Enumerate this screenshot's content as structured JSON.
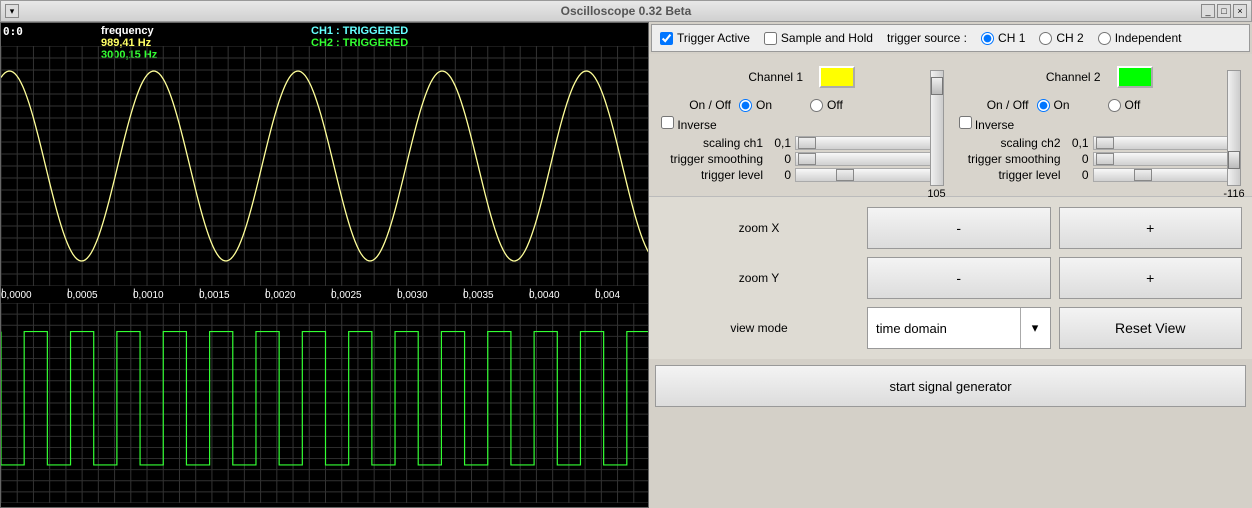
{
  "window": {
    "title": "Oscilloscope 0.32 Beta"
  },
  "scope": {
    "coord": "0:0",
    "freq_label": "frequency",
    "ch1_freq": "989,41 Hz",
    "ch2_freq": "3000,15 Hz",
    "ch1_status": "CH1 : TRIGGERED",
    "ch2_status": "CH2 : TRIGGERED",
    "time_ticks": [
      "0,0000",
      "0,0005",
      "0,0010",
      "0,0015",
      "0,0020",
      "0,0025",
      "0,0030",
      "0,0035",
      "0,0040",
      "0,004"
    ]
  },
  "trigger_bar": {
    "trigger_active": "Trigger Active",
    "sample_hold": "Sample and Hold",
    "source_label": "trigger source :",
    "ch1": "CH 1",
    "ch2": "CH 2",
    "independent": "Independent"
  },
  "channels": {
    "ch1": {
      "title": "Channel 1",
      "color": "#ffff00",
      "onoff_label": "On / Off",
      "on": "On",
      "off": "Off",
      "inverse": "Inverse",
      "scaling_label": "scaling ch1",
      "scaling_val": "0,1",
      "smooth_label": "trigger smoothing",
      "smooth_val": "0",
      "level_label": "trigger level",
      "level_val": "0",
      "vslider_val": "105"
    },
    "ch2": {
      "title": "Channel 2",
      "color": "#00ff00",
      "onoff_label": "On / Off",
      "on": "On",
      "off": "Off",
      "inverse": "Inverse",
      "scaling_label": "scaling ch2",
      "scaling_val": "0,1",
      "smooth_label": "trigger smoothing",
      "smooth_val": "0",
      "level_label": "trigger level",
      "level_val": "0",
      "vslider_val": "-116"
    }
  },
  "zoom": {
    "zoomx": "zoom X",
    "zoomy": "zoom Y",
    "minus": "-",
    "plus": "+",
    "viewmode": "view mode",
    "viewmode_val": "time domain",
    "reset": "Reset View"
  },
  "gen_button": "start signal generator",
  "chart_data": [
    {
      "type": "line",
      "title": "CH1 waveform",
      "color": "#ffff99",
      "shape": "sine",
      "frequency_hz": 989.41,
      "cycles_visible": 4.5,
      "amplitude": 1.0,
      "x_range_s": [
        0,
        0.0045
      ],
      "y_range": [
        -1,
        1
      ]
    },
    {
      "type": "line",
      "title": "CH2 waveform",
      "color": "#33ff33",
      "shape": "square",
      "frequency_hz": 3000.15,
      "cycles_visible": 14,
      "amplitude": 1.0,
      "x_range_s": [
        0,
        0.0045
      ],
      "x_ticks": [
        0.0,
        0.0005,
        0.001,
        0.0015,
        0.002,
        0.0025,
        0.003,
        0.0035,
        0.004
      ],
      "y_range": [
        -1,
        1
      ]
    }
  ]
}
